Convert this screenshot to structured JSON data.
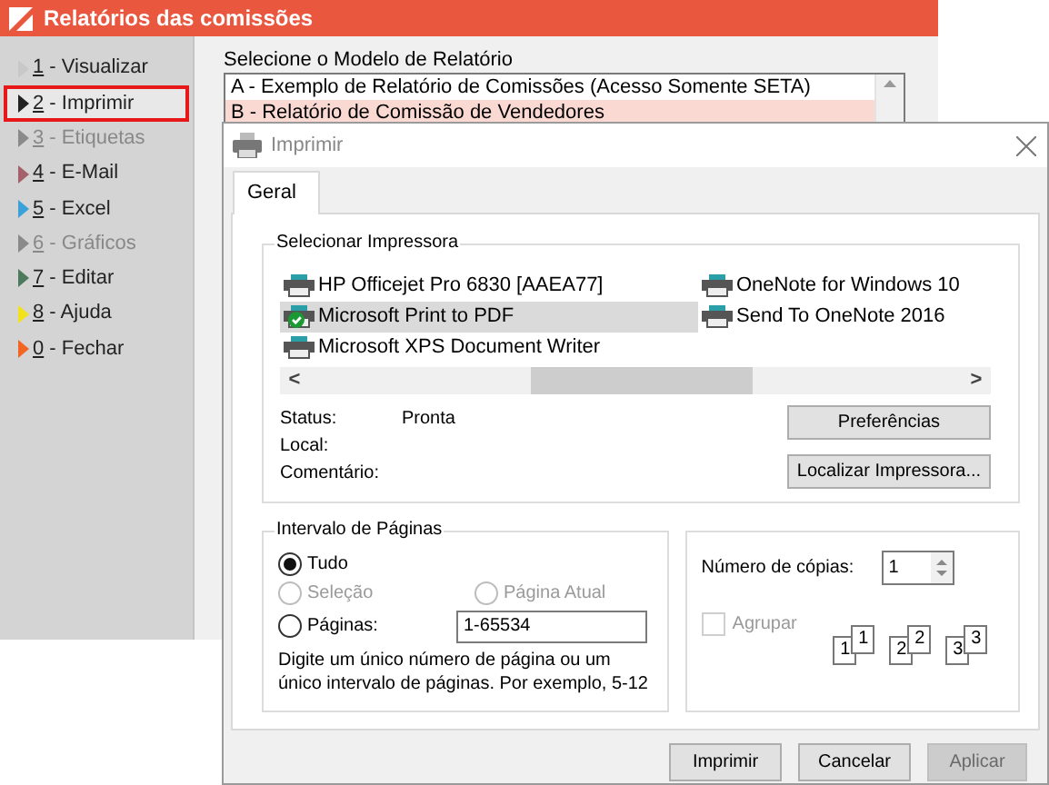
{
  "app": {
    "title": "Relatórios das comissões",
    "menu": [
      {
        "key": "1",
        "text": " - Visualizar",
        "color": "#c8c8c8",
        "disabled": false,
        "selected": false
      },
      {
        "key": "2",
        "text": " - Imprimir",
        "color": "#222222",
        "disabled": false,
        "selected": true
      },
      {
        "key": "3",
        "text": " - Etiquetas",
        "color": "#8a8a8a",
        "disabled": true,
        "selected": false
      },
      {
        "key": "4",
        "text": " - E-Mail",
        "color": "#a5616b",
        "disabled": false,
        "selected": false
      },
      {
        "key": "5",
        "text": " - Excel",
        "color": "#3aa2d8",
        "disabled": false,
        "selected": false
      },
      {
        "key": "6",
        "text": " - Gráficos",
        "color": "#8a8a8a",
        "disabled": true,
        "selected": false
      },
      {
        "key": "7",
        "text": " - Editar",
        "color": "#4d7a5c",
        "disabled": false,
        "selected": false
      },
      {
        "key": "8",
        "text": " - Ajuda",
        "color": "#f2e21c",
        "disabled": false,
        "selected": false
      },
      {
        "key": "0",
        "text": " - Fechar",
        "color": "#f26522",
        "disabled": false,
        "selected": false
      }
    ],
    "report_label": "Selecione o Modelo de Relatório",
    "reports": [
      {
        "text": "A - Exemplo de Relatório de Comissões (Acesso Somente SETA)",
        "selected": false
      },
      {
        "text": "B - Relatório de Comissão de Vendedores",
        "selected": true
      }
    ]
  },
  "dialog": {
    "title": "Imprimir",
    "tabs": [
      {
        "label": "Geral",
        "selected": true
      }
    ],
    "printer_group": "Selecionar Impressora",
    "printers": [
      {
        "name": "HP Officejet Pro 6830 [AAEA77]",
        "default": false,
        "selected": false
      },
      {
        "name": "Microsoft Print to PDF",
        "default": true,
        "selected": true
      },
      {
        "name": "Microsoft XPS Document Writer",
        "default": false,
        "selected": false
      },
      {
        "name": "OneNote for Windows 10",
        "default": false,
        "selected": false
      },
      {
        "name": "Send To OneNote 2016",
        "default": false,
        "selected": false
      }
    ],
    "scroll_left": "<",
    "scroll_right": ">",
    "info": [
      {
        "label": "Status:",
        "value": "Pronta"
      },
      {
        "label": "Local:"
      },
      {
        "label": "Comentário:"
      }
    ],
    "side_buttons": [
      "Preferências",
      "Localizar Impressora..."
    ],
    "range_group": "Intervalo de Páginas",
    "ranges": [
      {
        "label": "Tudo",
        "checked": true,
        "disabled": false
      },
      {
        "label": "Seleção",
        "checked": false,
        "disabled": true
      },
      {
        "label": "Página Atual",
        "checked": false,
        "disabled": true
      },
      {
        "label": "Páginas:",
        "checked": false,
        "disabled": false,
        "value": "1-65534"
      }
    ],
    "range_hint": "Digite um único número de página ou um único intervalo de páginas. Por exemplo, 5-12",
    "copies_label": "Número de cópias:",
    "copies": "1",
    "collate": {
      "label": "Agrupar",
      "checked": false,
      "disabled": true
    },
    "collate_pages": [
      {
        "front": "1",
        "back": "1"
      },
      {
        "front": "2",
        "back": "2"
      },
      {
        "front": "3",
        "back": "3"
      }
    ],
    "buttons": [
      {
        "label": "Imprimir",
        "disabled": false
      },
      {
        "label": "Cancelar",
        "disabled": false
      },
      {
        "label": "Aplicar",
        "disabled": true
      }
    ]
  }
}
